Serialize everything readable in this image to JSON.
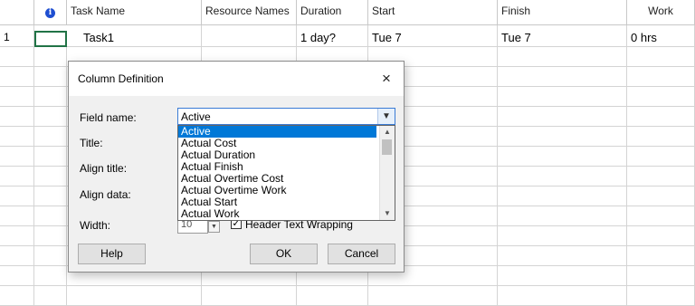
{
  "table": {
    "columns": {
      "info": "i",
      "task_name": "Task Name",
      "resource_names": "Resource Names",
      "duration": "Duration",
      "start": "Start",
      "finish": "Finish",
      "work": "Work"
    },
    "row": {
      "id": "1",
      "task_name": "Task1",
      "duration": "1 day?",
      "start": "Tue 7",
      "finish": "Tue 7",
      "work": "0 hrs"
    }
  },
  "dialog": {
    "title": "Column Definition",
    "close_icon": "×",
    "field_name_label": "Field name:",
    "field_name_value": "Active",
    "title_label": "Title:",
    "align_title_label": "Align title:",
    "align_data_label": "Align data:",
    "width_label": "Width:",
    "width_value": "10",
    "header_wrap_label": "Header Text Wrapping",
    "header_wrap_checked": "✓",
    "options": [
      "Active",
      "Actual Cost",
      "Actual Duration",
      "Actual Finish",
      "Actual Overtime Cost",
      "Actual Overtime Work",
      "Actual Start",
      "Actual Work"
    ],
    "help_button": "Help",
    "ok_button": "OK",
    "cancel_button": "Cancel"
  },
  "colors": {
    "selection": "#0078d7",
    "info_icon": "#1f4fd1",
    "cell_border": "#217346"
  }
}
